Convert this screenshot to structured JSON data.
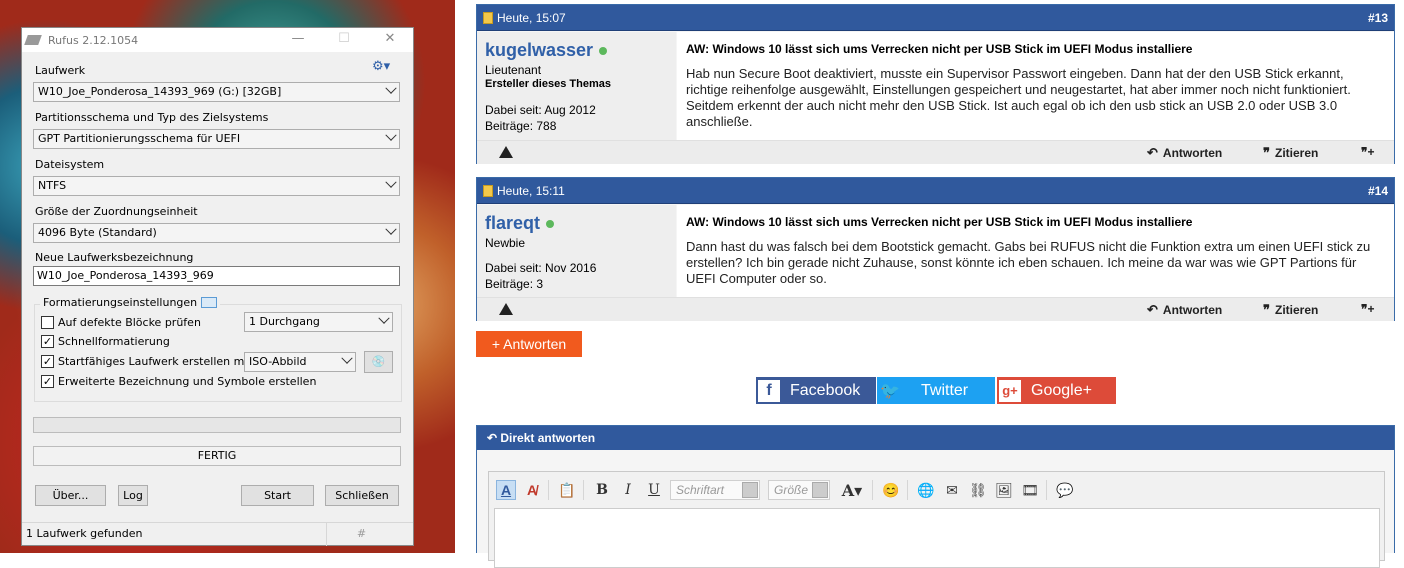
{
  "rufus": {
    "title": "Rufus 2.12.1054",
    "drive_label": "Laufwerk",
    "drive_value": "W10_Joe_Ponderosa_14393_969 (G:) [32GB]",
    "scheme_label": "Partitionsschema und Typ des Zielsystems",
    "scheme_value": "GPT Partitionierungsschema für UEFI",
    "fs_label": "Dateisystem",
    "fs_value": "NTFS",
    "cluster_label": "Größe der Zuordnungseinheit",
    "cluster_value": "4096 Byte (Standard)",
    "volume_label": "Neue Laufwerksbezeichnung",
    "volume_value": "W10_Joe_Ponderosa_14393_969",
    "format_group": "Formatierungseinstellungen",
    "check_bad": "Auf defekte Blöcke prüfen",
    "check_bad_checked": false,
    "passes_value": "1 Durchgang",
    "quick_format": "Schnellformatierung",
    "quick_format_checked": true,
    "bootable": "Startfähiges Laufwerk erstellen mit",
    "bootable_checked": true,
    "boot_type": "ISO-Abbild",
    "extended": "Erweiterte Bezeichnung und Symbole erstellen",
    "extended_checked": true,
    "progress": 0,
    "status": "FERTIG",
    "about_btn": "Über...",
    "log_btn": "Log",
    "start_btn": "Start",
    "close_btn": "Schließen",
    "statusbar": "1 Laufwerk gefunden",
    "statusbar_hash": "#"
  },
  "posts": [
    {
      "date": "Heute, 15:07",
      "num": "#13",
      "user": "kugelwasser",
      "rank": "Lieutenant",
      "role": "Ersteller dieses Themas",
      "joined": "Dabei seit: Aug 2012",
      "count": "Beiträge: 788",
      "title": "AW: Windows 10 lässt sich ums Verrecken nicht per USB Stick im UEFI Modus installiere",
      "body": "Hab nun Secure Boot deaktiviert, musste ein Supervisor Passwort eingeben. Dann hat der den USB Stick erkannt, richtige reihenfolge ausgewählt, Einstellungen gespeichert und neugestartet, hat aber immer noch nicht funktioniert. Seitdem erkennt der auch nicht mehr den USB Stick. Ist auch egal ob ich den usb stick an USB 2.0 oder USB 3.0 anschließe."
    },
    {
      "date": "Heute, 15:11",
      "num": "#14",
      "user": "flareqt",
      "rank": "Newbie",
      "role": "",
      "joined": "Dabei seit: Nov 2016",
      "count": "Beiträge: 3",
      "title": "AW: Windows 10 lässt sich ums Verrecken nicht per USB Stick im UEFI Modus installiere",
      "body": "Dann hast du was falsch bei dem Bootstick gemacht. Gabs bei RUFUS nicht die Funktion extra um einen UEFI stick zu erstellen? Ich bin gerade nicht Zuhause, sonst könnte ich eben schauen. Ich meine da war was wie GPT Partions für UEFI Computer oder so."
    }
  ],
  "actions": {
    "reply": "Antworten",
    "quote": "Zitieren"
  },
  "reply_button": "+ Antworten",
  "social": [
    {
      "label": "Facebook",
      "color": "#3b5998"
    },
    {
      "label": "Twitter",
      "color": "#1da1f2"
    },
    {
      "label": "Google+",
      "color": "#dd4b39"
    }
  ],
  "quick_reply": {
    "title": "Direkt antworten",
    "font_placeholder": "Schriftart",
    "size_placeholder": "Größe"
  }
}
